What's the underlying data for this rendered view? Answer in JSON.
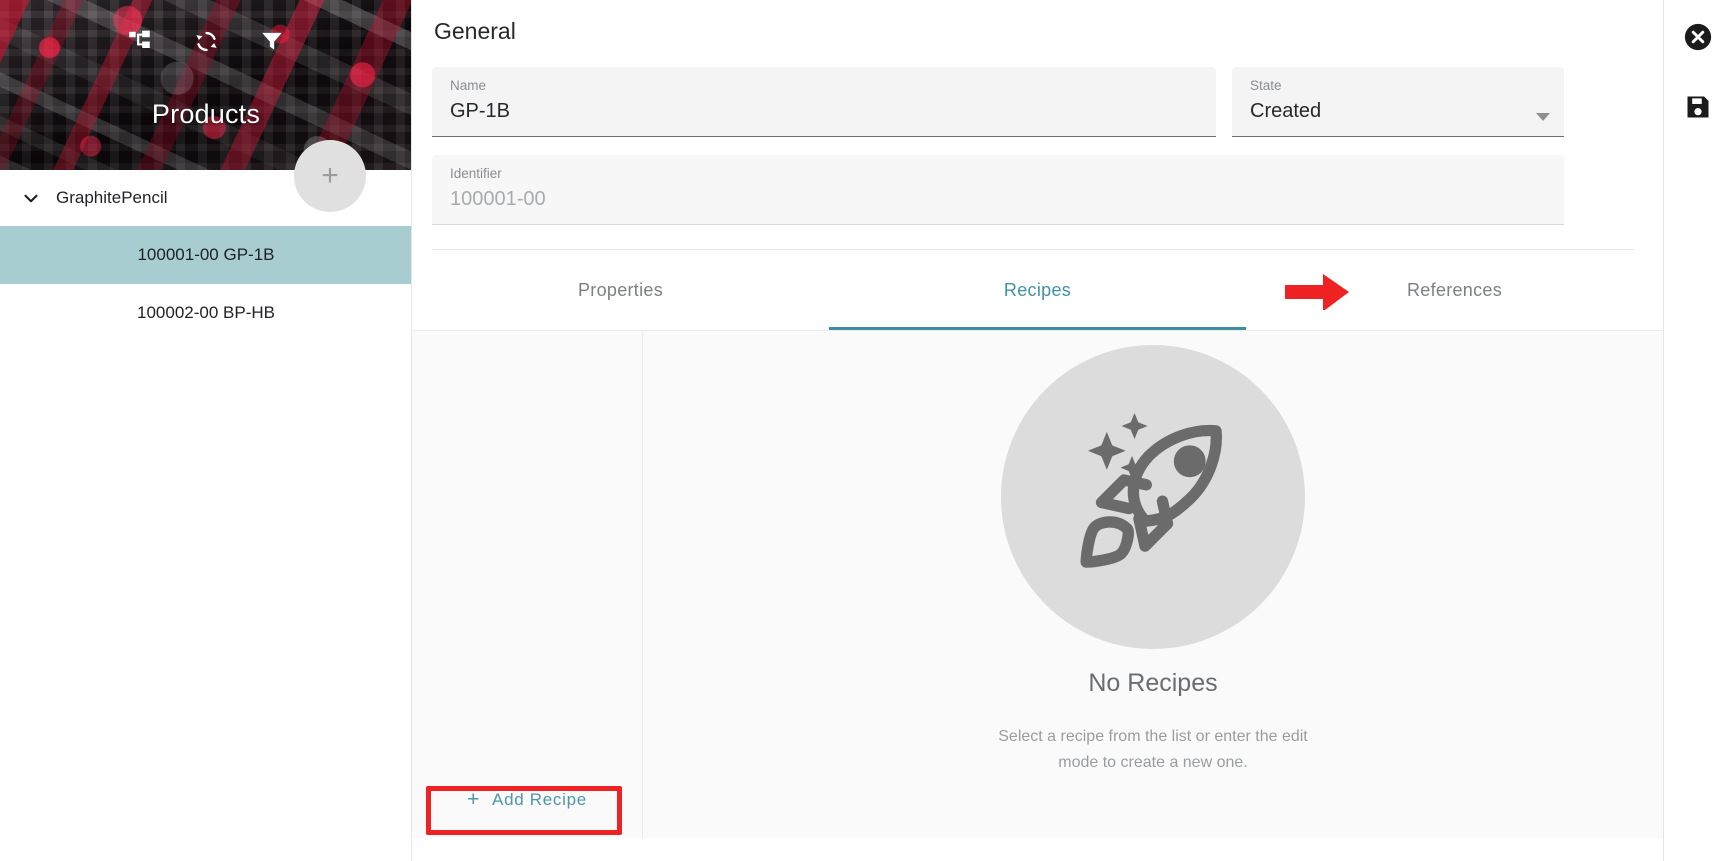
{
  "sidebar": {
    "title": "Products",
    "header_icons": [
      {
        "name": "hierarchy-icon",
        "label": "Hierarchy"
      },
      {
        "name": "sync-icon",
        "label": "Synchronize"
      },
      {
        "name": "filter-icon",
        "label": "Filter"
      }
    ],
    "add_button_label": "+",
    "tree": {
      "group_label": "GraphitePencil",
      "expanded": true,
      "items": [
        {
          "label": "100001-00 GP-1B",
          "selected": true
        },
        {
          "label": "100002-00 BP-HB",
          "selected": false
        }
      ]
    }
  },
  "main": {
    "section_title": "General",
    "fields": {
      "name": {
        "label": "Name",
        "value": "GP-1B",
        "placeholder": "Name"
      },
      "state": {
        "label": "State",
        "value": "Created",
        "placeholder": "State"
      },
      "identifier": {
        "label": "Identifier",
        "value": "100001-00",
        "placeholder": "Identifier",
        "disabled": true
      }
    },
    "tabs": [
      {
        "label": "Properties",
        "active": false
      },
      {
        "label": "Recipes",
        "active": true
      },
      {
        "label": "References",
        "active": false
      }
    ],
    "recipes": {
      "add_recipe_label": "Add Recipe",
      "add_recipe_plus": "+",
      "empty_title": "No Recipes",
      "empty_description": "Select a recipe from the list or enter the edit mode to create a new one."
    }
  },
  "right_rail": {
    "buttons": [
      {
        "name": "close-icon",
        "label": "Close"
      },
      {
        "name": "save-icon",
        "label": "Save"
      }
    ]
  },
  "colors": {
    "accent_teal": "#3f8d9e",
    "selection_teal": "#a8cdd0",
    "annotation_red": "#ee2222",
    "empty_circle": "#dcdcdc"
  }
}
